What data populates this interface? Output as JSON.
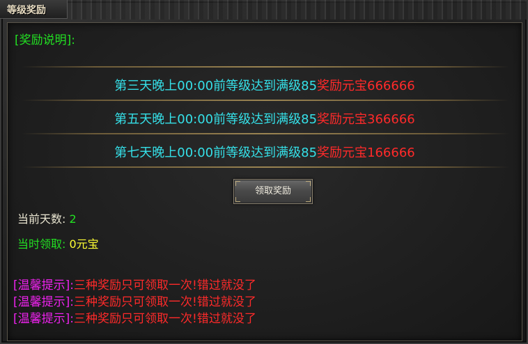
{
  "window": {
    "title": "等级奖励"
  },
  "description": {
    "header": "[奖励说明]:"
  },
  "rewards": [
    {
      "condition": "第三天晚上00:00前等级达到满级85",
      "reward": "奖励元宝666666"
    },
    {
      "condition": "第五天晚上00:00前等级达到满级85",
      "reward": "奖励元宝366666"
    },
    {
      "condition": "第七天晚上00:00前等级达到满级85",
      "reward": "奖励元宝166666"
    }
  ],
  "claim_button": {
    "label": "领取奖励"
  },
  "status": {
    "day_label": "当前天数:",
    "day_value": "2",
    "claim_label": "当时领取:",
    "claim_value": "0元宝"
  },
  "tips": [
    {
      "tag": "[温馨提示]:",
      "message": "三种奖励只可领取一次!错过就没了"
    },
    {
      "tag": "[温馨提示]:",
      "message": "三种奖励只可领取一次!错过就没了"
    },
    {
      "tag": "[温馨提示]:",
      "message": "三种奖励只可领取一次!错过就没了"
    }
  ],
  "colors": {
    "header_green": "#22e022",
    "condition_cyan": "#35e0e8",
    "reward_red": "#ff2a2a",
    "tip_magenta": "#ee22ee",
    "value_yellow": "#ffff33"
  }
}
